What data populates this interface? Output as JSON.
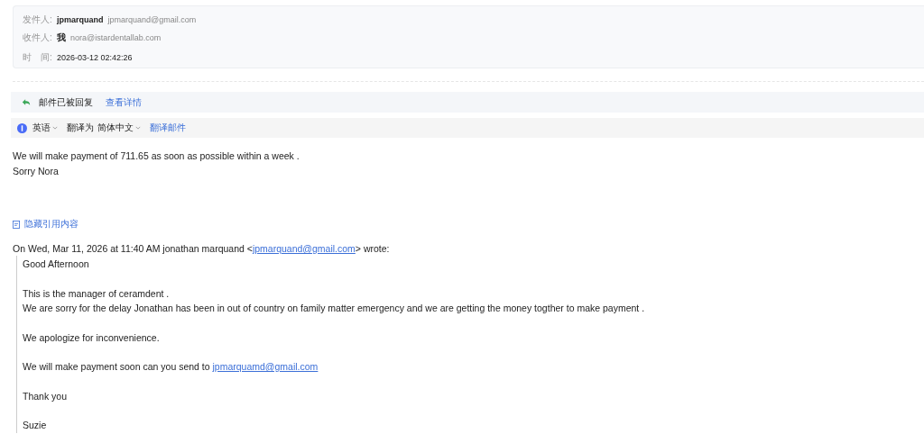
{
  "header": {
    "rows": [
      {
        "label": "发件人:",
        "name": "jpmarquand",
        "address": "jpmarquand@gmail.com"
      },
      {
        "label": "收件人:",
        "name": "我",
        "address": "nora@istardentallab.com"
      },
      {
        "label": "时　间:",
        "name": "2026-03-12 02:42:26"
      }
    ]
  },
  "reply_notice": {
    "text": "邮件已被回复",
    "link": "查看详情"
  },
  "translate_bar": {
    "source_language": "英语",
    "translate_to": "翻译为",
    "target_language": "简体中文",
    "action": "翻译邮件"
  },
  "body": [
    "We will make payment of 711.65 as soon as possible within a week .",
    "Sorry Nora"
  ],
  "hide_quote": "隐藏引用内容",
  "quote_header": {
    "before": "On Wed, Mar 11, 2026 at 11:40 AM jonathan marquand <",
    "link": "jpmarquand@gmail.com",
    "after": "> wrote:"
  },
  "quote": [
    {
      "kind": "text",
      "lines": [
        "Good Afternoon"
      ]
    },
    {
      "kind": "text",
      "lines": [
        "This is the manager of ceramdent .",
        "We are sorry for the delay Jonathan has been in out of country on family matter emergency and we are getting the money togther to make payment ."
      ]
    },
    {
      "kind": "text",
      "lines": [
        "We apologize for inconvenience."
      ]
    },
    {
      "kind": "link",
      "text": "We will make payment soon can you send to ",
      "link": "jpmarquamd@gmail.com"
    },
    {
      "kind": "text",
      "lines": [
        "Thank you"
      ]
    },
    {
      "kind": "text",
      "lines": [
        "Suzie"
      ]
    }
  ]
}
